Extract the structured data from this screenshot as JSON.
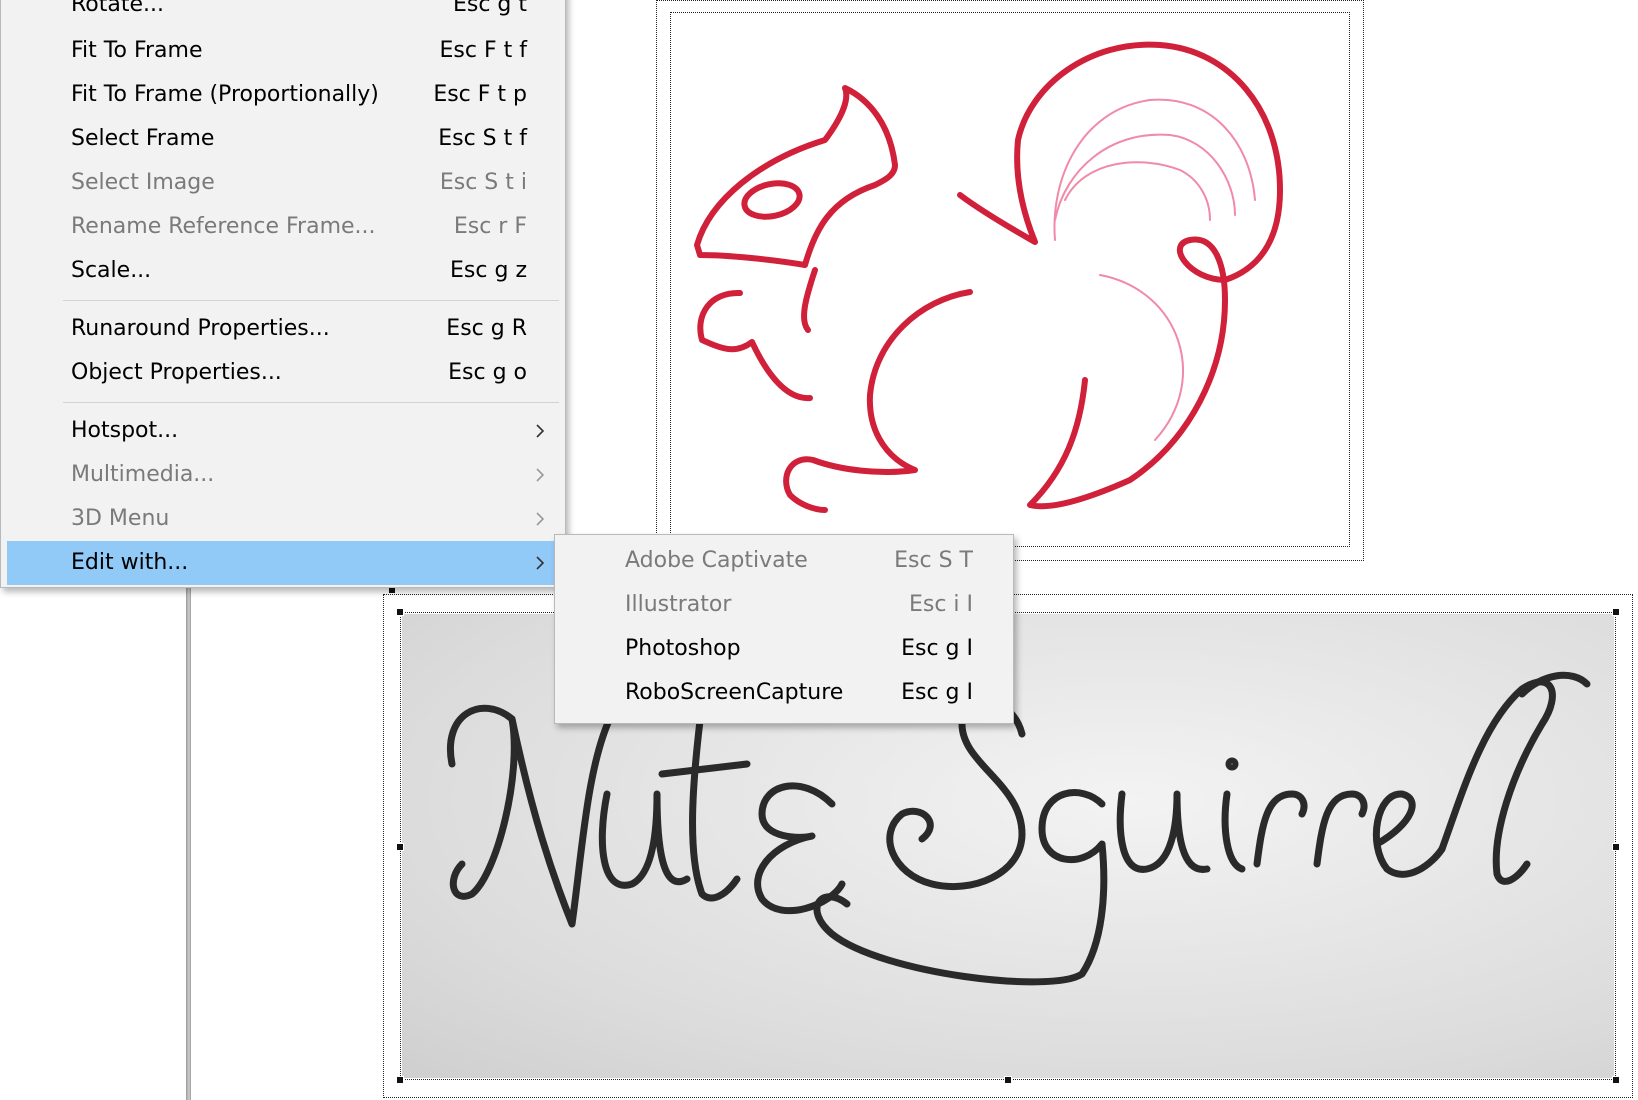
{
  "menu": {
    "items": [
      {
        "label": "Rotate...",
        "shortcut": "Esc g t",
        "enabled": true
      },
      {
        "label": "Fit To Frame",
        "shortcut": "Esc F t f",
        "enabled": true
      },
      {
        "label": "Fit To Frame (Proportionally)",
        "shortcut": "Esc F t p",
        "enabled": true
      },
      {
        "label": "Select Frame",
        "shortcut": "Esc S t f",
        "enabled": true
      },
      {
        "label": "Select Image",
        "shortcut": "Esc S t i",
        "enabled": false
      },
      {
        "label": "Rename Reference Frame...",
        "shortcut": "Esc r F",
        "enabled": false
      },
      {
        "label": "Scale...",
        "shortcut": "Esc g z",
        "enabled": true
      },
      {
        "label": "Runaround Properties...",
        "shortcut": "Esc g R",
        "enabled": true
      },
      {
        "label": "Object Properties...",
        "shortcut": "Esc g o",
        "enabled": true
      },
      {
        "label": "Hotspot...",
        "enabled": true,
        "submenu": true,
        "arrow_icon": "chevron-right-icon"
      },
      {
        "label": "Multimedia...",
        "enabled": false,
        "submenu": true,
        "arrow_icon": "chevron-right-icon"
      },
      {
        "label": "3D Menu",
        "enabled": false,
        "submenu": true,
        "arrow_icon": "chevron-right-icon"
      },
      {
        "label": "Edit with...",
        "enabled": true,
        "submenu": true,
        "highlighted": true,
        "arrow_icon": "chevron-right-icon"
      }
    ]
  },
  "submenu": {
    "items": [
      {
        "label": "Adobe Captivate",
        "shortcut": "Esc S T",
        "enabled": false
      },
      {
        "label": "Illustrator",
        "shortcut": "Esc i I",
        "enabled": false
      },
      {
        "label": "Photoshop",
        "shortcut": "Esc g I",
        "enabled": true
      },
      {
        "label": "RoboScreenCapture",
        "shortcut": "Esc g I",
        "enabled": true
      }
    ]
  },
  "document": {
    "squirrel_image": {
      "icon": "squirrel-logo",
      "color": "#d0203a",
      "tail_accent_color": "#f08aa8"
    },
    "lettering_image": {
      "text": "Nut & Squirrel",
      "icon": "handwritten-lettering-image"
    }
  },
  "colors": {
    "menu_bg": "#f2f2f2",
    "highlight": "#91c9f7",
    "disabled_text": "#7a7a7a"
  }
}
